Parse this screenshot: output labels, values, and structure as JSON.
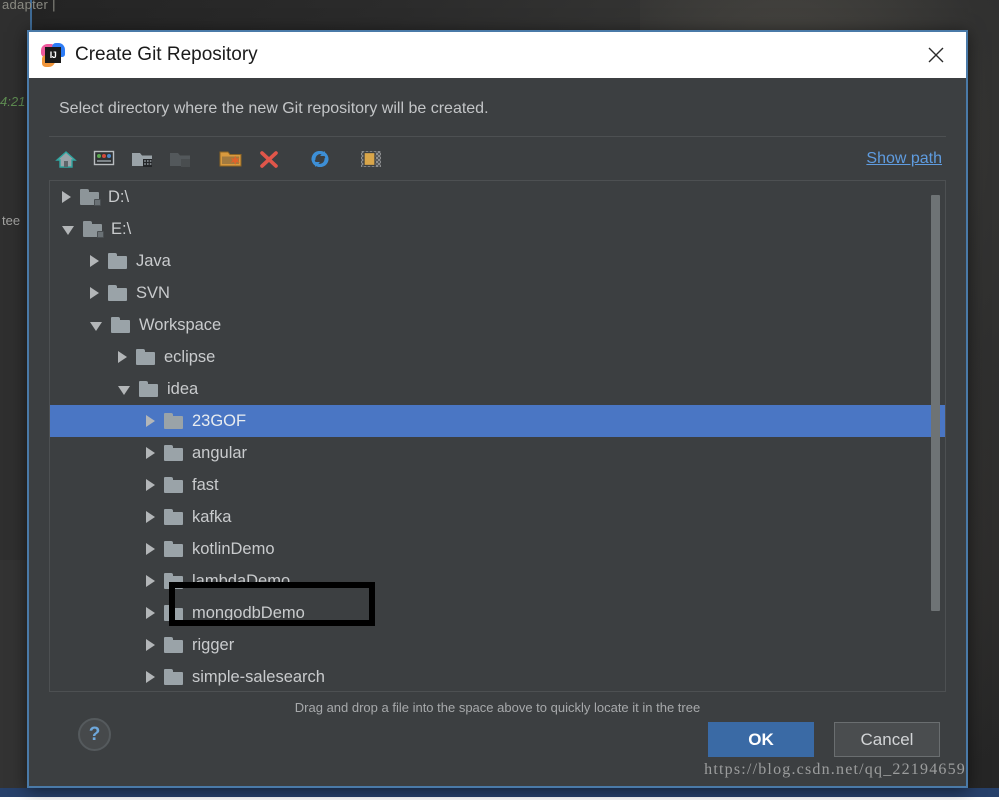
{
  "background": {
    "top_code": "adapter |",
    "green_code": "4:21",
    "gray_code": "tee"
  },
  "dialog": {
    "title": "Create Git Repository",
    "app_icon": "intellij-idea-icon",
    "icon_text": "IJ",
    "close_icon": "close-icon",
    "subtitle": "Select directory where the new Git repository will be created.",
    "toolbar": {
      "show_path_label": "Show path",
      "buttons": [
        {
          "name": "home-icon",
          "enabled": true
        },
        {
          "name": "desktop-icon",
          "enabled": true
        },
        {
          "name": "project-folder-icon",
          "enabled": true
        },
        {
          "name": "module-folder-icon",
          "enabled": false
        },
        {
          "name": "new-folder-icon",
          "enabled": true
        },
        {
          "name": "delete-icon",
          "enabled": true
        },
        {
          "name": "refresh-icon",
          "enabled": true
        },
        {
          "name": "show-hidden-files-icon",
          "enabled": true
        }
      ]
    },
    "tree": {
      "rows": [
        {
          "label": "D:\\",
          "indent": 0,
          "state": "collapsed",
          "icon": "drive-folder-icon",
          "locked": true,
          "selected": false
        },
        {
          "label": "E:\\",
          "indent": 0,
          "state": "expanded",
          "icon": "drive-folder-icon",
          "locked": true,
          "selected": false
        },
        {
          "label": "Java",
          "indent": 1,
          "state": "collapsed",
          "icon": "folder-icon",
          "locked": false,
          "selected": false
        },
        {
          "label": "SVN",
          "indent": 1,
          "state": "collapsed",
          "icon": "folder-icon",
          "locked": false,
          "selected": false
        },
        {
          "label": "Workspace",
          "indent": 1,
          "state": "expanded",
          "icon": "folder-icon",
          "locked": false,
          "selected": false
        },
        {
          "label": "eclipse",
          "indent": 2,
          "state": "collapsed",
          "icon": "folder-icon",
          "locked": false,
          "selected": false
        },
        {
          "label": "idea",
          "indent": 2,
          "state": "expanded",
          "icon": "folder-icon",
          "locked": false,
          "selected": false
        },
        {
          "label": "23GOF",
          "indent": 3,
          "state": "collapsed",
          "icon": "folder-icon",
          "locked": false,
          "selected": true
        },
        {
          "label": "angular",
          "indent": 3,
          "state": "collapsed",
          "icon": "folder-icon",
          "locked": false,
          "selected": false
        },
        {
          "label": "fast",
          "indent": 3,
          "state": "collapsed",
          "icon": "folder-icon",
          "locked": false,
          "selected": false
        },
        {
          "label": "kafka",
          "indent": 3,
          "state": "collapsed",
          "icon": "folder-icon",
          "locked": false,
          "selected": false
        },
        {
          "label": "kotlinDemo",
          "indent": 3,
          "state": "collapsed",
          "icon": "folder-icon",
          "locked": false,
          "selected": false
        },
        {
          "label": "lambdaDemo",
          "indent": 3,
          "state": "collapsed",
          "icon": "folder-icon",
          "locked": false,
          "selected": false
        },
        {
          "label": "mongodbDemo",
          "indent": 3,
          "state": "collapsed",
          "icon": "folder-icon",
          "locked": false,
          "selected": false
        },
        {
          "label": "rigger",
          "indent": 3,
          "state": "collapsed",
          "icon": "folder-icon",
          "locked": false,
          "selected": false
        },
        {
          "label": "simple-salesearch",
          "indent": 3,
          "state": "collapsed",
          "icon": "folder-icon",
          "locked": false,
          "selected": false
        }
      ]
    },
    "hint": "Drag and drop a file into the space above to quickly locate it in the tree",
    "footer": {
      "help_label": "?",
      "ok_label": "OK",
      "cancel_label": "Cancel"
    }
  },
  "watermark": "https://blog.csdn.net/qq_22194659",
  "colors": {
    "dialog_bg": "#3c3f41",
    "dialog_border": "#4a7aa8",
    "selection": "#4a76c4",
    "link": "#5f9ce0",
    "primary_button": "#3a6aa5",
    "annotation": "#000000"
  }
}
